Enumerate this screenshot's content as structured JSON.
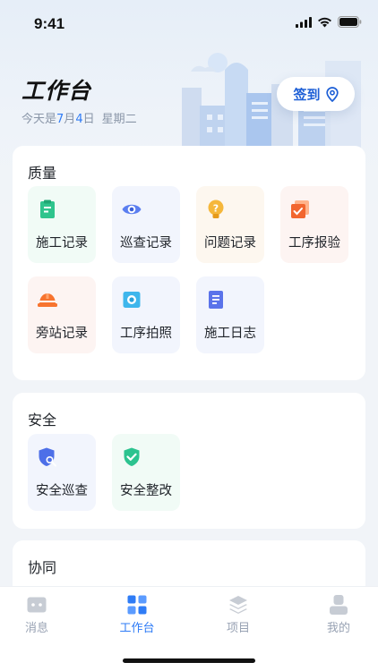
{
  "status": {
    "time": "9:41"
  },
  "header": {
    "title": "工作台",
    "date_prefix": "今天是",
    "month": "7",
    "month_unit": "月",
    "day": "4",
    "day_unit": "日",
    "weekday": "星期二",
    "checkin_label": "签到"
  },
  "sections": {
    "quality": {
      "title": "质量",
      "items": [
        {
          "label": "施工记录",
          "icon": "clipboard-icon"
        },
        {
          "label": "巡查记录",
          "icon": "eye-icon"
        },
        {
          "label": "问题记录",
          "icon": "question-bulb-icon"
        },
        {
          "label": "工序报验",
          "icon": "layers-check-icon"
        },
        {
          "label": "旁站记录",
          "icon": "helmet-icon"
        },
        {
          "label": "工序拍照",
          "icon": "camera-icon"
        },
        {
          "label": "施工日志",
          "icon": "document-icon"
        }
      ]
    },
    "safety": {
      "title": "安全",
      "items": [
        {
          "label": "安全巡查",
          "icon": "shield-search-icon"
        },
        {
          "label": "安全整改",
          "icon": "shield-check-icon"
        }
      ]
    },
    "collab": {
      "title": "协同"
    }
  },
  "tabbar": {
    "items": [
      {
        "label": "消息",
        "icon": "message-icon"
      },
      {
        "label": "工作台",
        "icon": "grid-icon"
      },
      {
        "label": "项目",
        "icon": "stack-icon"
      },
      {
        "label": "我的",
        "icon": "user-icon"
      }
    ],
    "active": "工作台"
  },
  "colors": {
    "accent": "#2f7cf6",
    "tile_green": "#f1fbf6",
    "tile_blue": "#f2f5fd",
    "tile_orange": "#fdf7ef",
    "tile_red": "#fdf4f2"
  }
}
